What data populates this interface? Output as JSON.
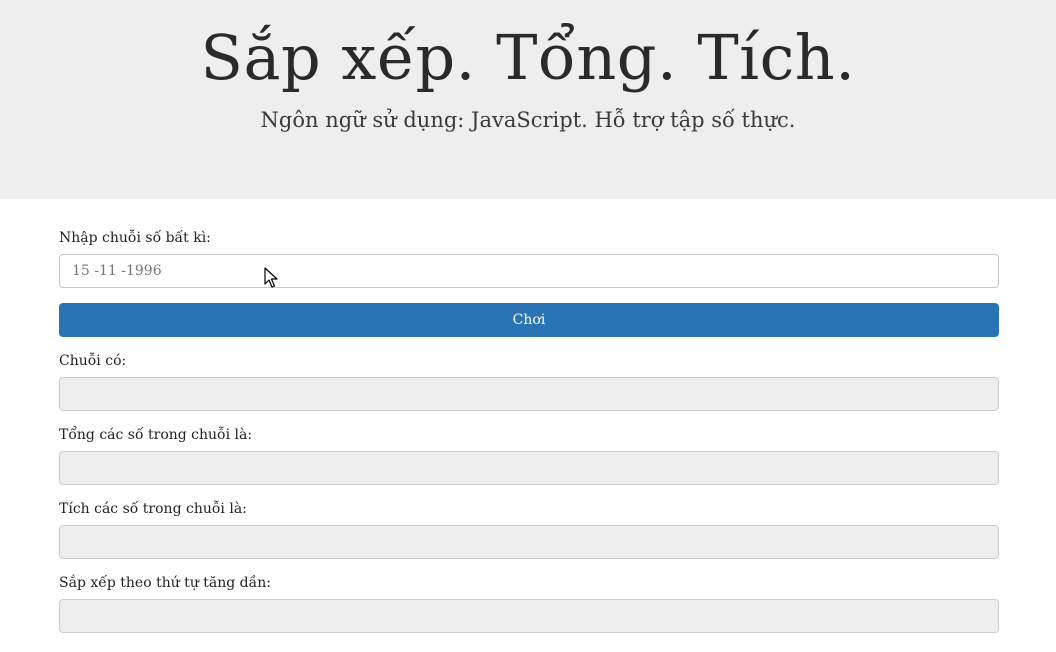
{
  "header": {
    "title": "Sắp xếp. Tổng. Tích.",
    "subtitle": "Ngôn ngữ sử dụng: JavaScript. Hỗ trợ tập số thực."
  },
  "form": {
    "input_label": "Nhập chuỗi số bất kì:",
    "input_placeholder": "15 -11 -1996",
    "input_value": "",
    "play_button": "Chơi",
    "outputs": [
      {
        "label": "Chuỗi có:",
        "value": ""
      },
      {
        "label": "Tổng các số trong chuỗi là:",
        "value": ""
      },
      {
        "label": "Tích các số trong chuỗi là:",
        "value": ""
      },
      {
        "label": "Sắp xếp theo thứ tự tăng dần:",
        "value": ""
      }
    ]
  },
  "colors": {
    "header_bg": "#eeeeee",
    "button_bg": "#2a74b5",
    "readonly_bg": "#eeeeee"
  }
}
